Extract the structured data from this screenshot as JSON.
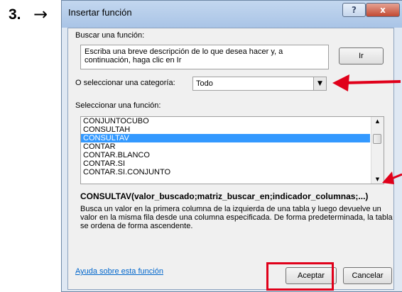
{
  "step": {
    "number": "3.",
    "arrow": "→"
  },
  "dialog": {
    "title": "Insertar función",
    "help_button": "?",
    "close_button": "x",
    "search_label": "Buscar una función:",
    "search_text": "Escriba una breve descripción de lo que desea hacer y, a continuación, haga clic en Ir",
    "go_button": "Ir",
    "category_label": "O seleccionar una categoría:",
    "category_value": "Todo",
    "function_label": "Seleccionar una función:",
    "functions": [
      "CONJUNTOCUBO",
      "CONSULTAH",
      "CONSULTAV",
      "CONTAR",
      "CONTAR.BLANCO",
      "CONTAR.SI",
      "CONTAR.SI.CONJUNTO"
    ],
    "selected_function": "CONSULTAV",
    "syntax": "CONSULTAV(valor_buscado;matriz_buscar_en;indicador_columnas;...)",
    "description": "Busca un valor en la primera columna de la izquierda de una tabla y luego devuelve un valor en la misma fila desde una columna especificada. De forma predeterminada, la tabla se ordena de forma ascendente.",
    "help_link": "Ayuda sobre esta función",
    "ok_button": "Aceptar",
    "cancel_button": "Cancelar"
  },
  "annotation_color": "#e0001a",
  "selection_color": "#3399ff"
}
